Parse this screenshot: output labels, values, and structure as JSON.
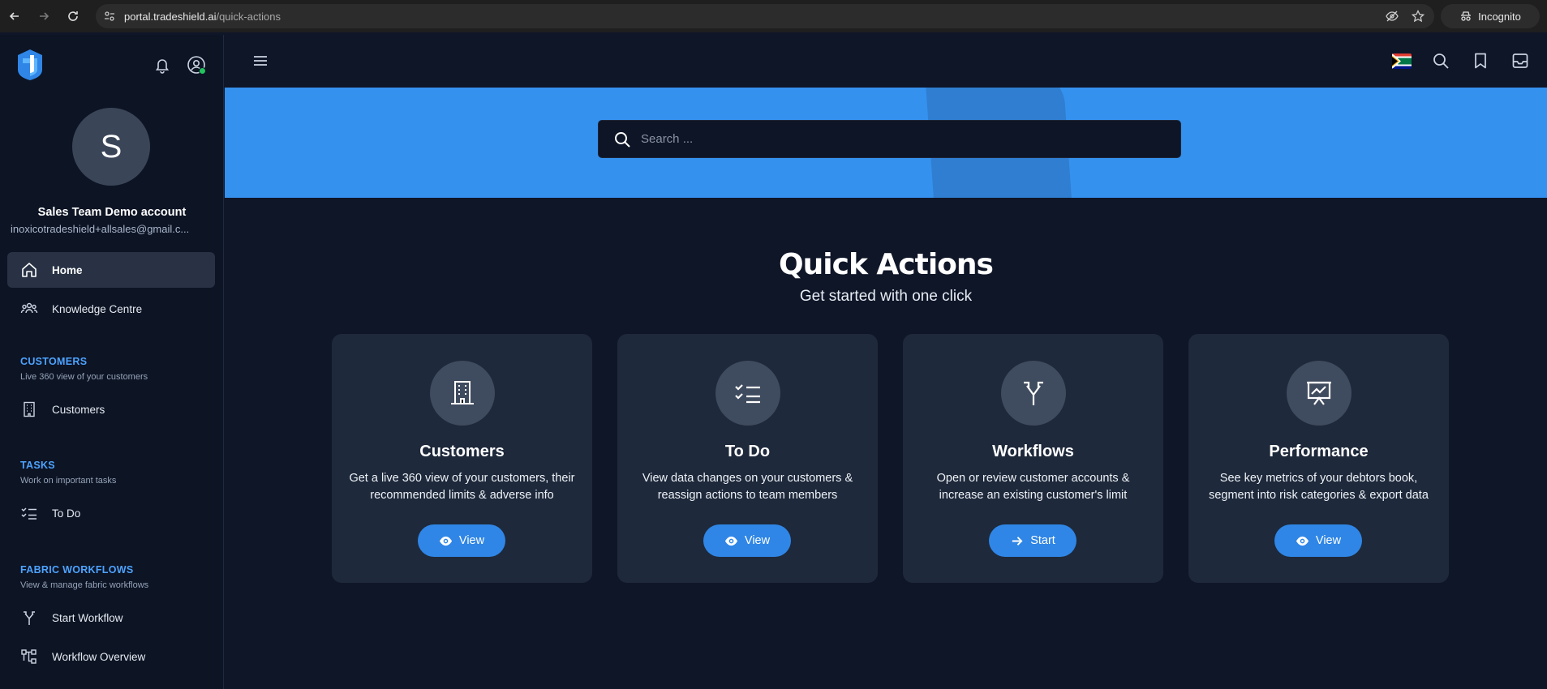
{
  "browser": {
    "url_host": "portal.tradeshield.ai",
    "url_path": "/quick-actions",
    "incognito_label": "Incognito"
  },
  "sidebar": {
    "avatar_initial": "S",
    "account_name": "Sales Team Demo account",
    "account_email": "inoxicotradeshield+allsales@gmail.c...",
    "items": [
      {
        "label": "Home",
        "icon": "home-icon",
        "active": true
      },
      {
        "label": "Knowledge Centre",
        "icon": "people-icon"
      }
    ],
    "sections": [
      {
        "title": "CUSTOMERS",
        "subtitle": "Live 360 view of your customers",
        "items": [
          {
            "label": "Customers",
            "icon": "building-icon"
          }
        ]
      },
      {
        "title": "TASKS",
        "subtitle": "Work on important tasks",
        "items": [
          {
            "label": "To Do",
            "icon": "checklist-icon"
          }
        ]
      },
      {
        "title": "FABRIC WORKFLOWS",
        "subtitle": "View & manage fabric workflows",
        "items": [
          {
            "label": "Start Workflow",
            "icon": "split-arrow-icon"
          },
          {
            "label": "Workflow Overview",
            "icon": "hierarchy-icon"
          }
        ]
      }
    ]
  },
  "search": {
    "placeholder": "Search ..."
  },
  "main": {
    "title": "Quick Actions",
    "subtitle": "Get started with one click",
    "cards": [
      {
        "title": "Customers",
        "description": "Get a live 360 view of your customers, their recommended limits & adverse info",
        "button": "View",
        "icon": "building-icon"
      },
      {
        "title": "To Do",
        "description": "View data changes on your customers & reassign actions to team members",
        "button": "View",
        "icon": "checklist-icon"
      },
      {
        "title": "Workflows",
        "description": "Open or review customer accounts & increase an existing customer's limit",
        "button": "Start",
        "icon": "split-arrow-icon"
      },
      {
        "title": "Performance",
        "description": "See key metrics of your debtors book, segment into risk categories & export data",
        "button": "View",
        "icon": "presentation-chart-icon"
      }
    ]
  },
  "colors": {
    "accent": "#3591ee",
    "button": "#2f86e6",
    "section_title": "#4da3ff",
    "sidebar_bg": "#0d1424",
    "card_bg": "#1e293b"
  }
}
